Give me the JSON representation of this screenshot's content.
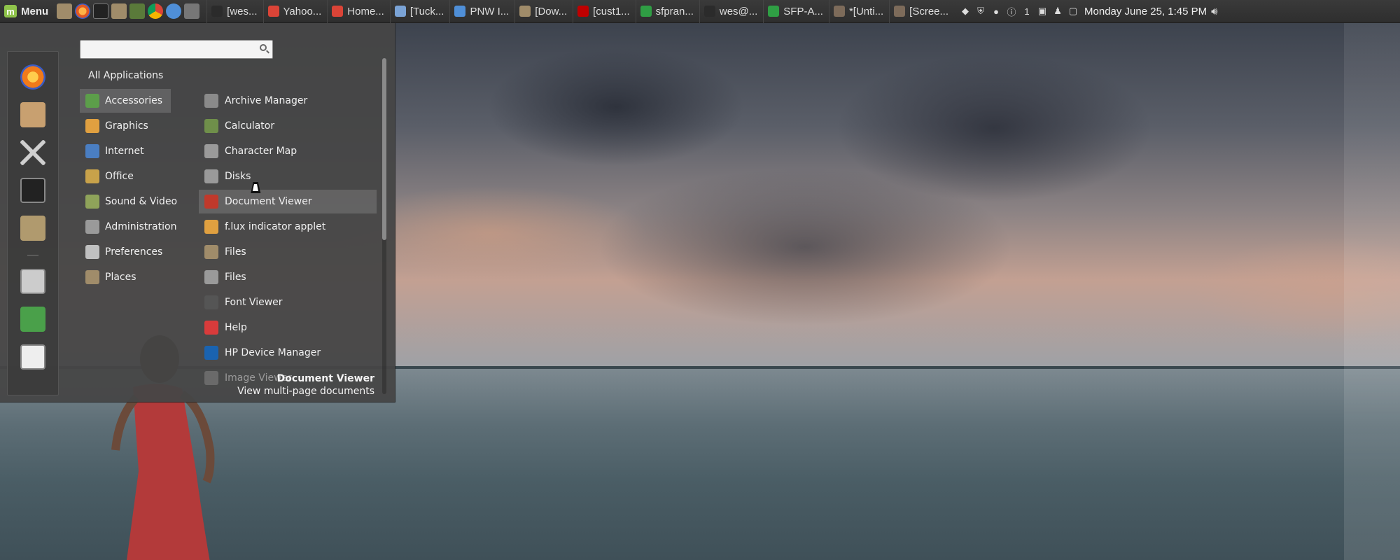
{
  "panel": {
    "menu_label": "Menu",
    "tasks": [
      {
        "label": "[wes...",
        "icon": "terminal-icon",
        "color": "#2b2b2b"
      },
      {
        "label": "Yahoo...",
        "icon": "chrome-icon",
        "color": "#db4437"
      },
      {
        "label": "Home...",
        "icon": "chrome-icon",
        "color": "#db4437"
      },
      {
        "label": "[Tuck...",
        "icon": "web-app-icon",
        "color": "#7aa3d6"
      },
      {
        "label": "PNW I...",
        "icon": "web-app-icon",
        "color": "#4f8fd8"
      },
      {
        "label": "[Dow...",
        "icon": "folder-icon",
        "color": "#a08c6a"
      },
      {
        "label": "[cust1...",
        "icon": "filezilla-icon",
        "color": "#bf0000"
      },
      {
        "label": "sfpran...",
        "icon": "spreadsheet-icon",
        "color": "#2f9e44"
      },
      {
        "label": "wes@...",
        "icon": "terminal-icon",
        "color": "#2b2b2b"
      },
      {
        "label": "SFP-A...",
        "icon": "spreadsheet-icon",
        "color": "#2f9e44"
      },
      {
        "label": "*[Unti...",
        "icon": "image-editor-icon",
        "color": "#7d6b5a"
      },
      {
        "label": "[Scree...",
        "icon": "screenshot-icon",
        "color": "#7d6b5a"
      }
    ],
    "tray_count": "1",
    "clock": "Monday June 25,  1:45 PM"
  },
  "menu": {
    "search_placeholder": "",
    "all_applications": "All Applications",
    "categories": [
      {
        "label": "Accessories",
        "color": "#5c9e4a",
        "active": true
      },
      {
        "label": "Graphics",
        "color": "#e0a040"
      },
      {
        "label": "Internet",
        "color": "#4a7ec2"
      },
      {
        "label": "Office",
        "color": "#c8a24a"
      },
      {
        "label": "Sound & Video",
        "color": "#8fa35a"
      },
      {
        "label": "Administration",
        "color": "#9a9a9a"
      },
      {
        "label": "Preferences",
        "color": "#c0c0c0"
      },
      {
        "label": "Places",
        "color": "#a08c6a"
      }
    ],
    "apps": [
      {
        "label": "Archive Manager",
        "icon": "archive-icon",
        "color": "#8a8a8a"
      },
      {
        "label": "Calculator",
        "icon": "calculator-icon",
        "color": "#6f8f4a"
      },
      {
        "label": "Character Map",
        "icon": "character-map-icon",
        "color": "#9a9a9a"
      },
      {
        "label": "Disks",
        "icon": "disks-icon",
        "color": "#9a9a9a"
      },
      {
        "label": "Document Viewer",
        "icon": "document-viewer-icon",
        "color": "#c0392b",
        "hover": true
      },
      {
        "label": "f.lux indicator applet",
        "icon": "flux-icon",
        "color": "#e0a040"
      },
      {
        "label": "Files",
        "icon": "folder-icon",
        "color": "#a08c6a"
      },
      {
        "label": "Files",
        "icon": "files-icon",
        "color": "#9a9a9a"
      },
      {
        "label": "Font Viewer",
        "icon": "font-viewer-icon",
        "color": "#555555"
      },
      {
        "label": "Help",
        "icon": "help-icon",
        "color": "#d93b3b"
      },
      {
        "label": "HP Device Manager",
        "icon": "hp-icon",
        "color": "#1a63b0"
      },
      {
        "label": "Image Viewer",
        "icon": "image-viewer-icon",
        "color": "#6a6a6a",
        "dim": true
      }
    ],
    "description": {
      "title": "Document Viewer",
      "text": "View multi-page documents"
    }
  }
}
